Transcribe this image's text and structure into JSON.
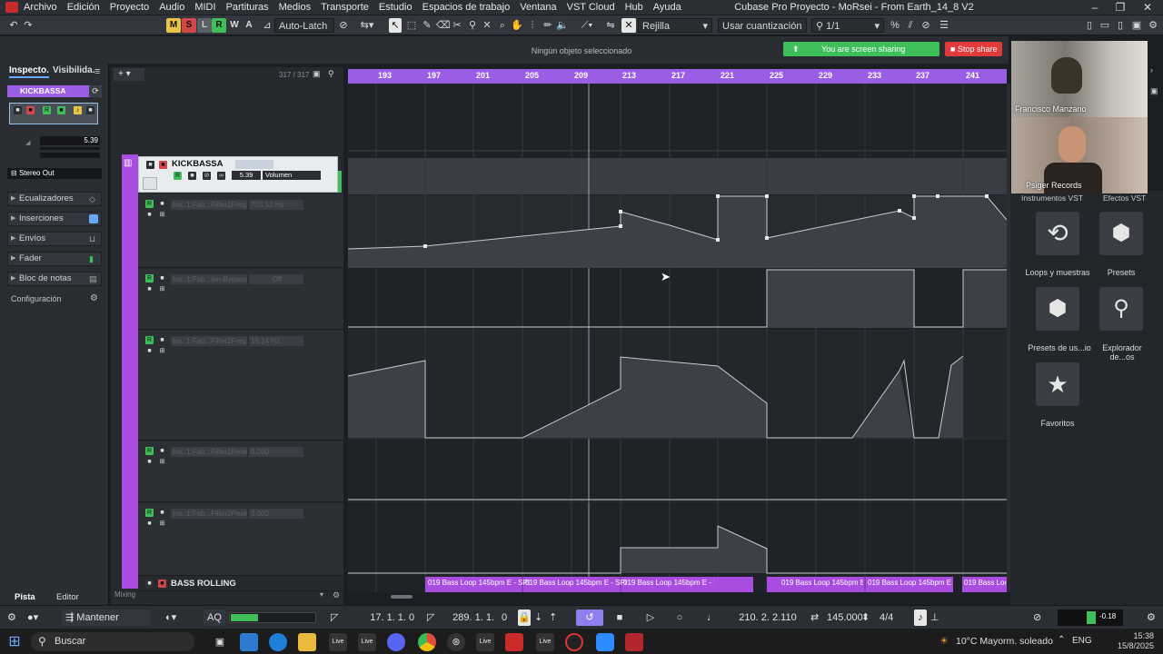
{
  "menubar": {
    "items": [
      "Archivo",
      "Edición",
      "Proyecto",
      "Audio",
      "MIDI",
      "Partituras",
      "Medios",
      "Transporte",
      "Estudio",
      "Espacios de trabajo",
      "Ventana",
      "VST Cloud",
      "Hub",
      "Ayuda"
    ],
    "title": "Cubase Pro Proyecto - MoRsei - From Earth_14_8 V2"
  },
  "toolbar": {
    "m": "M",
    "s": "S",
    "l": "L",
    "r": "R",
    "w": "W",
    "a": "A",
    "automation_mode": "Auto-Latch",
    "snap_type": "Rejilla",
    "quantize": "Usar cuantización",
    "quantize_value": "1/1"
  },
  "info": {
    "status": "Ningún objeto seleccionado",
    "share_label": "You are screen sharing",
    "stop_share": "Stop share",
    "track_count": "317 / 317"
  },
  "inspector": {
    "tab_inspector": "Inspecto.",
    "tab_visibility": "Visibilida.",
    "track_name": "KICKBASSA",
    "volume": "5.39",
    "output": "Stereo Out",
    "sections": [
      "Ecualizadores",
      "Inserciones",
      "Envíos",
      "Fader",
      "Bloc de notas"
    ],
    "config": "Configuración",
    "bottom_tab_track": "Pista",
    "bottom_tab_editor": "Editor"
  },
  "track": {
    "name": "KICKBASSA",
    "volume_value": "5.39",
    "param": "Volumen",
    "lanes": [
      {
        "label": "Ins.:1:Fab...Filter1Freq",
        "value": "703.52 Hz"
      },
      {
        "label": "Ins.:1:Fab...ion-Bypass",
        "value": "Off"
      },
      {
        "label": "Ins.:1:Fab...Filter2Freq",
        "value": "19.14 Hz"
      },
      {
        "label": "Ins.:1:Fab...Filter1Peak",
        "value": "0.000"
      },
      {
        "label": "Ins.:1:Fab...Filter2Peak",
        "value": "0.000"
      }
    ],
    "next_track": "BASS ROLLING",
    "mixing": "Mixing"
  },
  "ruler": {
    "bars": [
      "193",
      "197",
      "201",
      "205",
      "209",
      "213",
      "217",
      "221",
      "225",
      "229",
      "233",
      "237",
      "241"
    ]
  },
  "clips": {
    "label": "019 Bass Loop 145bpm E - SPI"
  },
  "mediabay": {
    "tab1": "Instrumentos VST",
    "tab2": "Efectos VST",
    "items": [
      "Loops y muestras",
      "Presets",
      "Presets de us...io",
      "Explorador de...os",
      "Favoritos"
    ]
  },
  "video": {
    "person1": "Francisco Manzano",
    "person2": "Psiger Records"
  },
  "transport": {
    "history": "Mantener historial",
    "aq": "AQ",
    "left_locator": "17. 1. 1.",
    "left_locator_tick": "0",
    "right_locator": "289. 1. 1.",
    "right_locator_tick": "0",
    "position": "210. 2. 2.110",
    "tempo": "145.000",
    "signature": "4/4",
    "level": "-0.18"
  },
  "taskbar": {
    "search": "Buscar",
    "weather": "10°C Mayorm. soleado",
    "lang": "ENG",
    "time": "15:38",
    "date": "15/8/2025"
  },
  "colors": {
    "accent": "#9b5de5",
    "green": "#3fbf5a",
    "red": "#e23a3a"
  }
}
